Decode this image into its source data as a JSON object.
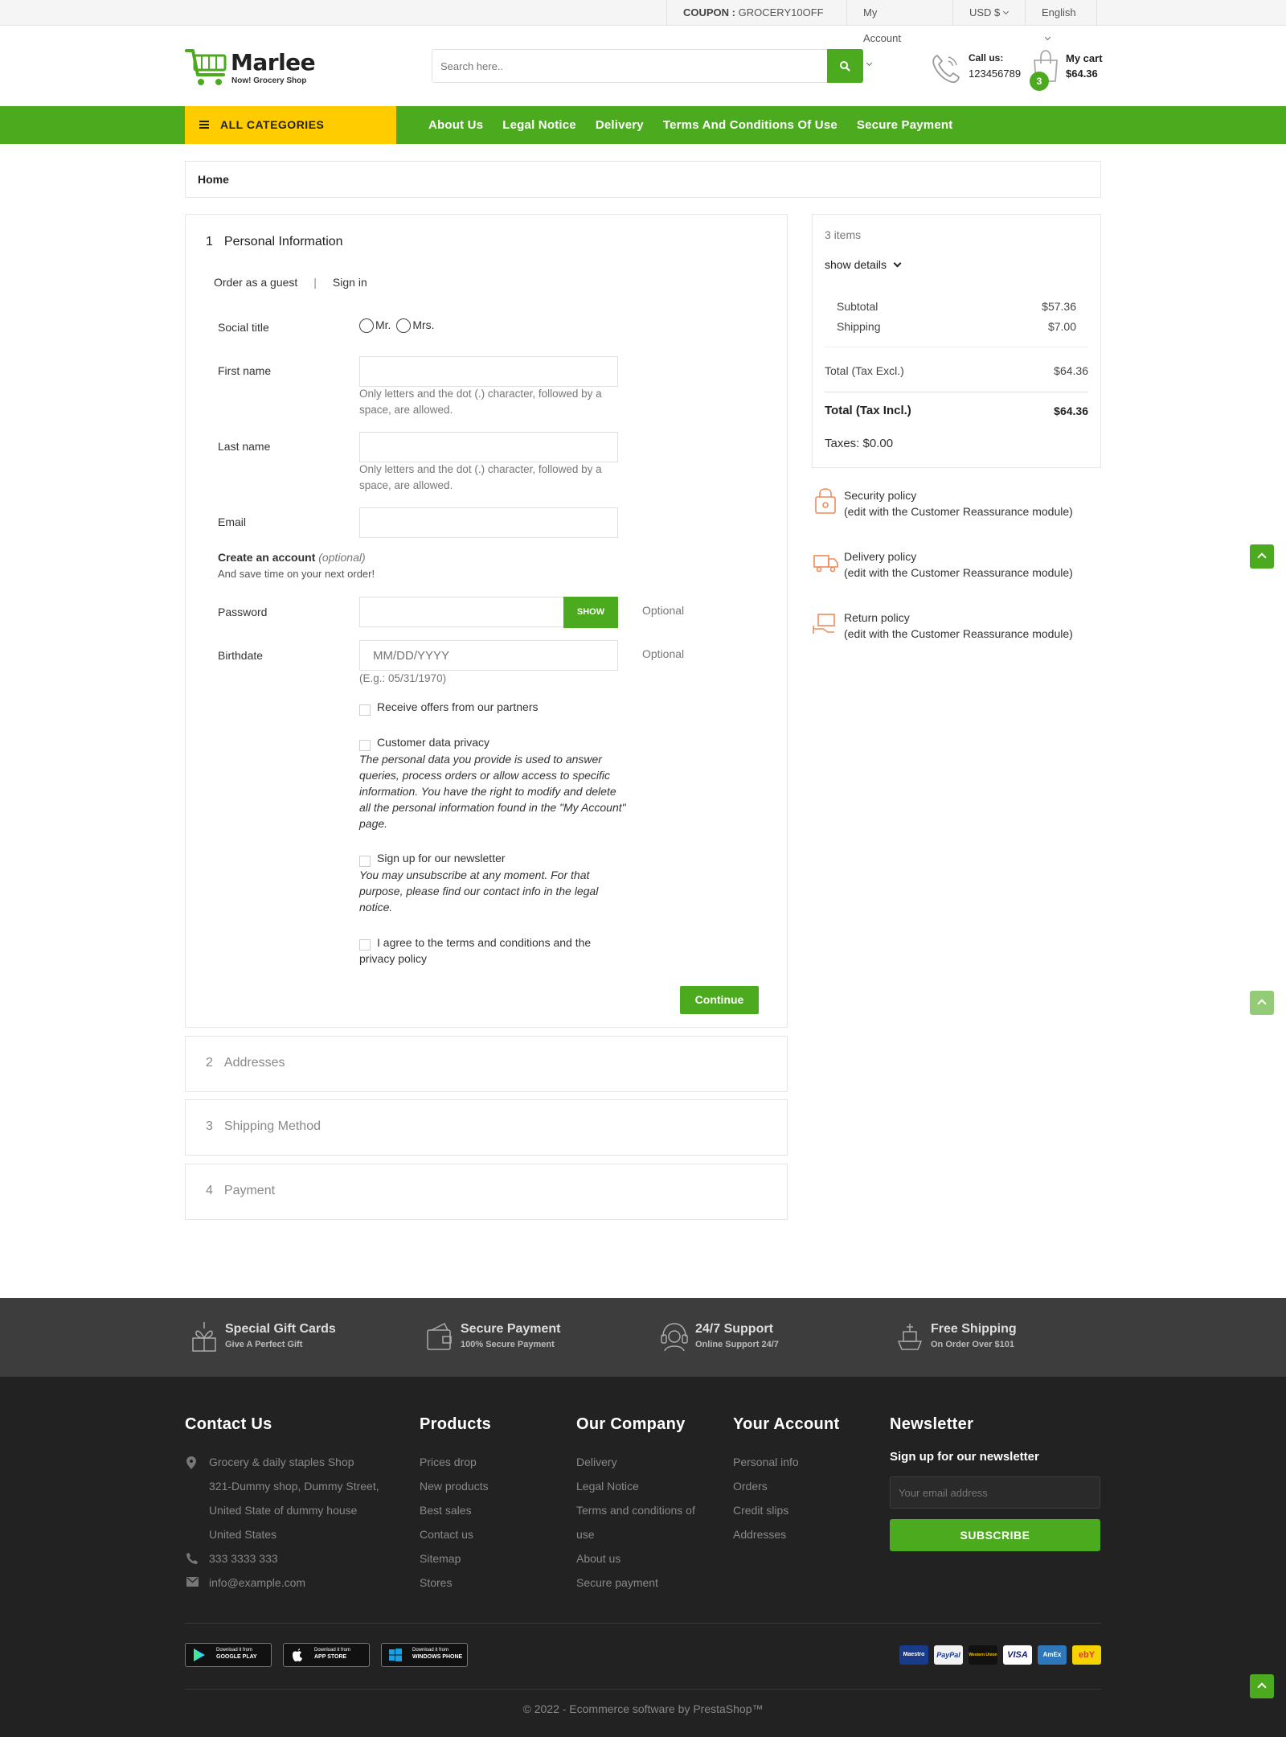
{
  "topbar": {
    "coupon_label": "COUPON :",
    "coupon_code": "GROCERY10OFF",
    "account": "My Account",
    "currency": "USD $",
    "language": "English"
  },
  "header": {
    "logo_name": "Marlee",
    "logo_tagline": "Now! Grocery Shop",
    "search_placeholder": "Search here..",
    "call_label": "Call us:",
    "call_number": "123456789",
    "cart_label": "My cart",
    "cart_amount": "$64.36",
    "cart_count": "3"
  },
  "nav": {
    "all_categories": "ALL CATEGORIES",
    "links": [
      "About Us",
      "Legal Notice",
      "Delivery",
      "Terms And Conditions Of Use",
      "Secure Payment"
    ]
  },
  "breadcrumb": "Home",
  "checkout": {
    "step1": {
      "num": "1",
      "title": "Personal Information"
    },
    "guest_label": "Order as a guest",
    "sep": "|",
    "signin_label": "Sign in",
    "social_title_label": "Social title",
    "mr": "Mr.",
    "mrs": "Mrs.",
    "first_name_label": "First name",
    "name_hint": "Only letters and the dot (.) character, followed by a space, are allowed.",
    "last_name_label": "Last name",
    "email_label": "Email",
    "create_account": "Create an account",
    "optional_italic": "(optional)",
    "save_time": "And save time on your next order!",
    "password_label": "Password",
    "show_btn": "SHOW",
    "optional": "Optional",
    "birthdate_label": "Birthdate",
    "birthdate_placeholder": "MM/DD/YYYY",
    "birthdate_hint": "(E.g.: 05/31/1970)",
    "partners": "Receive offers from our partners",
    "privacy_label": "Customer data privacy",
    "privacy_desc": "The personal data you provide is used to answer queries, process orders or allow access to specific information. You have the right to modify and delete all the personal information found in the \"My Account\" page.",
    "newsletter_label": "Sign up for our newsletter",
    "newsletter_desc": "You may unsubscribe at any moment. For that purpose, please find our contact info in the legal notice.",
    "terms": "I agree to the terms and conditions and the privacy policy",
    "continue": "Continue",
    "step2": {
      "num": "2",
      "title": "Addresses"
    },
    "step3": {
      "num": "3",
      "title": "Shipping Method"
    },
    "step4": {
      "num": "4",
      "title": "Payment"
    }
  },
  "summary": {
    "items": "3 items",
    "show_details": "show details",
    "subtotal_label": "Subtotal",
    "subtotal": "$57.36",
    "shipping_label": "Shipping",
    "shipping": "$7.00",
    "total_excl_label": "Total (Tax Excl.)",
    "total_excl": "$64.36",
    "total_incl_label": "Total (Tax Incl.)",
    "total_incl": "$64.36",
    "taxes": "Taxes: $0.00"
  },
  "reassurance": [
    {
      "title": "Security policy",
      "desc": "(edit with the Customer Reassurance module)"
    },
    {
      "title": "Delivery policy",
      "desc": "(edit with the Customer Reassurance module)"
    },
    {
      "title": "Return policy",
      "desc": "(edit with the Customer Reassurance module)"
    }
  ],
  "services": [
    {
      "title": "Special Gift Cards",
      "sub": "Give A Perfect Gift"
    },
    {
      "title": "Secure Payment",
      "sub": "100% Secure Payment"
    },
    {
      "title": "24/7 Support",
      "sub": "Online Support 24/7"
    },
    {
      "title": "Free Shipping",
      "sub": "On Order Over $101"
    }
  ],
  "footer": {
    "contact_title": "Contact Us",
    "contact_address": [
      "Grocery & daily staples Shop",
      "321-Dummy shop, Dummy Street,",
      "United State of dummy house",
      "United States"
    ],
    "contact_phone": "333 3333 333",
    "contact_email": "info@example.com",
    "products_title": "Products",
    "products": [
      "Prices drop",
      "New products",
      "Best sales",
      "Contact us",
      "Sitemap",
      "Stores"
    ],
    "company_title": "Our Company",
    "company": [
      "Delivery",
      "Legal Notice",
      "Terms and conditions of",
      "use",
      "About us",
      "Secure payment"
    ],
    "account_title": "Your Account",
    "account": [
      "Personal info",
      "Orders",
      "Credit slips",
      "Addresses"
    ],
    "newsletter_title": "Newsletter",
    "newsletter_sub": "Sign up for our newsletter",
    "email_placeholder": "Your email address",
    "subscribe": "SUBSCRIBE",
    "stores": [
      {
        "top": "Download it from",
        "bottom": "GOOGLE PLAY"
      },
      {
        "top": "Download it from",
        "bottom": "APP STORE"
      },
      {
        "top": "Download it from",
        "bottom": "WINDOWS PHONE"
      }
    ],
    "payments": [
      "Maestro",
      "PayPal",
      "Western Union",
      "VISA",
      "AmEx",
      "ebY"
    ],
    "copyright": "© 2022 - Ecommerce software by PrestaShop™"
  },
  "colors": {
    "accent": "#4caa1e",
    "yellow": "#ffcc00",
    "footer": "#222222"
  }
}
